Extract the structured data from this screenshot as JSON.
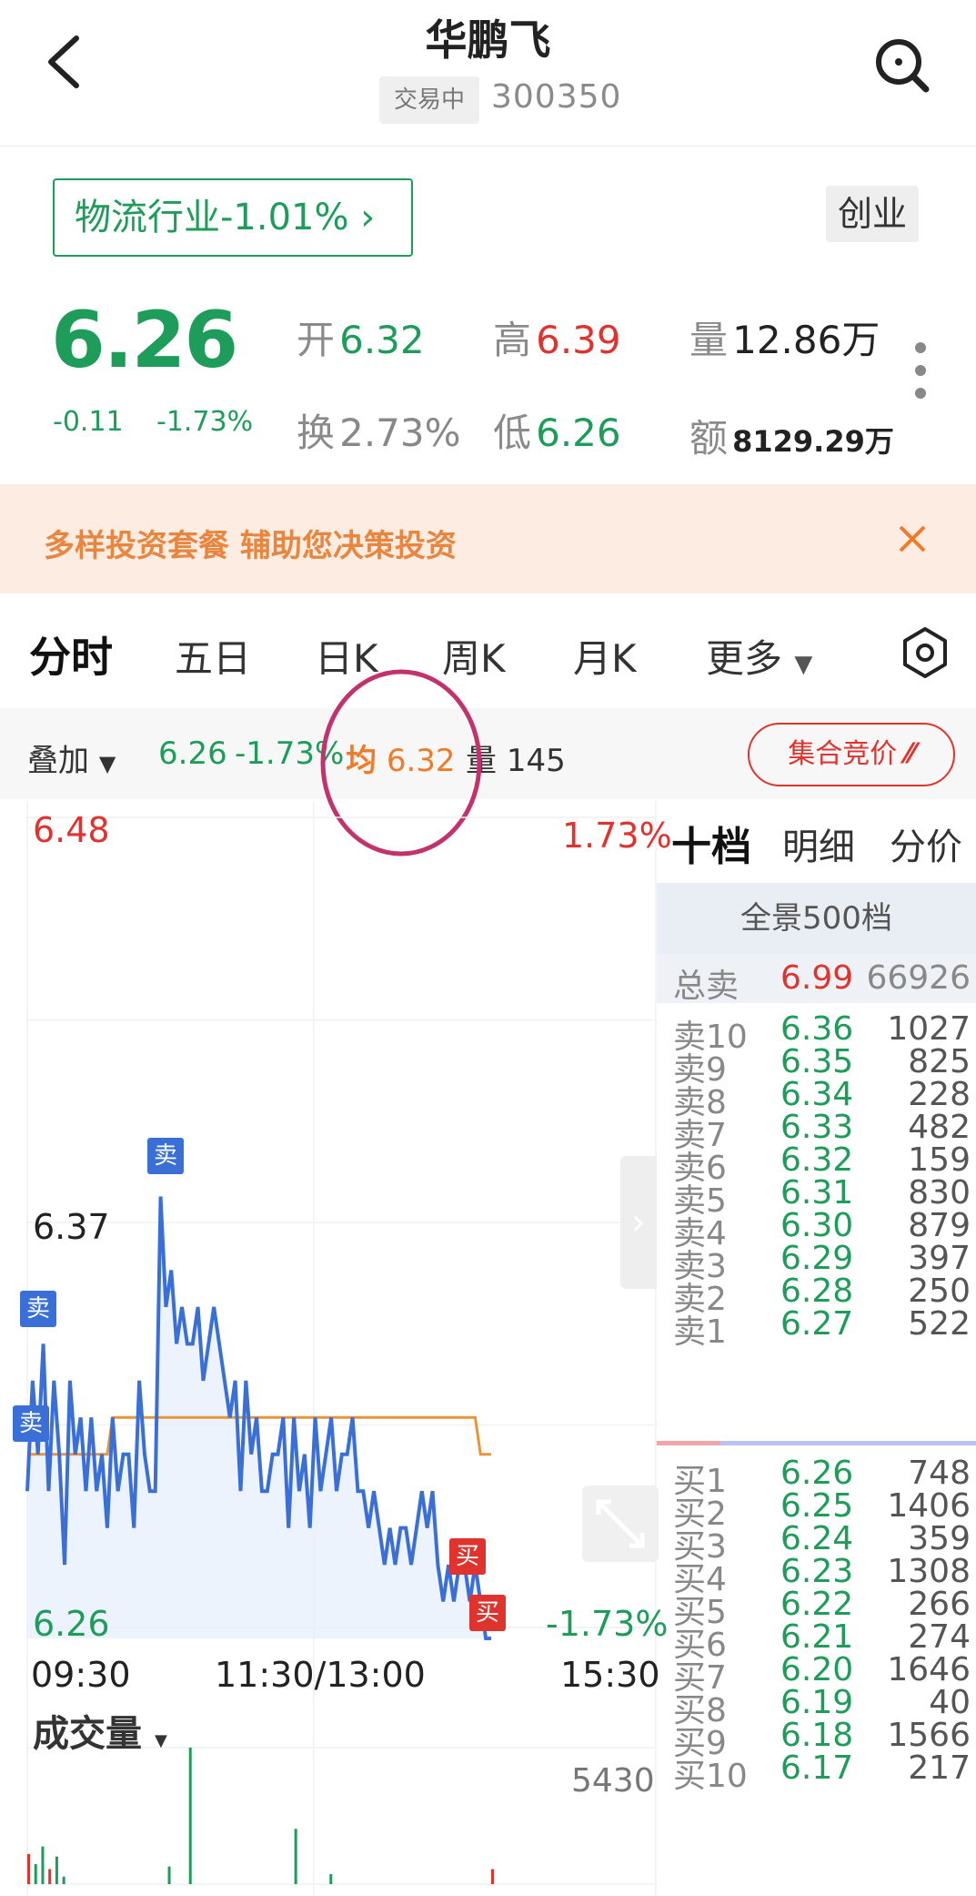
{
  "header": {
    "title": "华鹏飞",
    "status": "交易中",
    "code": "300350"
  },
  "sector": {
    "label": "物流行业-1.01% ",
    "board": "创业"
  },
  "quote": {
    "price": "6.26",
    "change_abs": "-0.11",
    "change_pct": "-1.73%",
    "open_label": "开",
    "open": "6.32",
    "high_label": "高",
    "high": "6.39",
    "volume_label": "量",
    "volume": "12.86万",
    "turnover_label": "换",
    "turnover": "2.73%",
    "low_label": "低",
    "low": "6.26",
    "amount_label": "额",
    "amount": "8129.29万"
  },
  "promo": {
    "text": "多样投资套餐 辅助您决策投资"
  },
  "tabs": [
    "分时",
    "五日",
    "日K",
    "周K",
    "月K",
    "更多"
  ],
  "toolbar": {
    "overlay": "叠加",
    "price": "6.26",
    "pct": "-1.73%",
    "avg_label": "均",
    "avg": "6.32",
    "vol_label": "量",
    "vol": "145",
    "auction": "集合竞价"
  },
  "chart": {
    "y_top": "6.48",
    "y_mid": "6.37",
    "y_bottom": "6.26",
    "pct_top": "1.73%",
    "pct_bottom": "-1.73%",
    "time_start": "09:30",
    "time_mid": "11:30/13:00",
    "time_end": "15:30",
    "volume_title": "成交量",
    "volume_max": "5430",
    "sell_marker": "卖",
    "buy_marker": "买"
  },
  "chart_data": {
    "type": "line",
    "title": "",
    "xlabel": "",
    "ylabel": "",
    "ylim": [
      6.26,
      6.48
    ],
    "x_ticks": [
      "09:30",
      "11:30/13:00",
      "15:30"
    ],
    "series": [
      {
        "name": "",
        "values": [
          6.3,
          6.33,
          6.31,
          6.34,
          6.3,
          6.33,
          6.31,
          6.28,
          6.33,
          6.31,
          6.32,
          6.3,
          6.32,
          6.3,
          6.31,
          6.29,
          6.32,
          6.3,
          6.31,
          6.31,
          6.29,
          6.33,
          6.31,
          6.3,
          6.3,
          6.38,
          6.35,
          6.36,
          6.34,
          6.35,
          6.34,
          6.34,
          6.35,
          6.33,
          6.34,
          6.35,
          6.34,
          6.33,
          6.32,
          6.33,
          6.3,
          6.33,
          6.31,
          6.32,
          6.3,
          6.3,
          6.31,
          6.31,
          6.32,
          6.29,
          6.32,
          6.3,
          6.31,
          6.29,
          6.32,
          6.3,
          6.31,
          6.32,
          6.3,
          6.31,
          6.31,
          6.32,
          6.3,
          6.3,
          6.29,
          6.3,
          6.29,
          6.28,
          6.29,
          6.28,
          6.29,
          6.29,
          6.28,
          6.29,
          6.3,
          6.29,
          6.3,
          6.28,
          6.27,
          6.28,
          6.27,
          6.28,
          6.28,
          6.27,
          6.28,
          6.27,
          6.26,
          6.26
        ]
      },
      {
        "name": "均",
        "values": [
          6.31,
          6.31,
          6.31,
          6.31,
          6.31,
          6.31,
          6.31,
          6.31,
          6.31,
          6.31,
          6.31,
          6.31,
          6.31,
          6.31,
          6.31,
          6.31,
          6.32,
          6.32,
          6.32,
          6.32,
          6.32,
          6.32,
          6.32,
          6.32,
          6.32,
          6.32,
          6.32,
          6.32,
          6.32,
          6.32,
          6.32,
          6.32,
          6.32,
          6.32,
          6.32,
          6.32,
          6.32,
          6.32,
          6.32,
          6.32,
          6.32,
          6.32,
          6.32,
          6.32,
          6.32,
          6.32,
          6.32,
          6.32,
          6.32,
          6.32,
          6.32,
          6.32,
          6.32,
          6.32,
          6.32,
          6.32,
          6.32,
          6.32,
          6.32,
          6.32,
          6.32,
          6.32,
          6.32,
          6.32,
          6.32,
          6.32,
          6.32,
          6.32,
          6.32,
          6.32,
          6.32,
          6.32,
          6.32,
          6.32,
          6.32,
          6.32,
          6.32,
          6.32,
          6.32,
          6.32,
          6.32,
          6.32,
          6.32,
          6.32,
          6.32,
          6.31,
          6.31,
          6.31
        ]
      }
    ],
    "volume_bars": [
      1200,
      800,
      1500,
      600,
      1100,
      300,
      0,
      0,
      0,
      0,
      0,
      0,
      0,
      0,
      0,
      0,
      0,
      0,
      0,
      0,
      700,
      0,
      0,
      5430,
      0,
      0,
      0,
      0,
      0,
      0,
      0,
      0,
      0,
      0,
      0,
      0,
      0,
      0,
      2200,
      0,
      0,
      0,
      0,
      400,
      0,
      0,
      0,
      0,
      0,
      0,
      0,
      0,
      0,
      0,
      0,
      0,
      0,
      0,
      0,
      0,
      0,
      0,
      0,
      0,
      0,
      0,
      600
    ]
  },
  "orderbook": {
    "tabs": [
      "十档",
      "明细",
      "分价"
    ],
    "panorama": "全景500档",
    "total": {
      "label": "总卖",
      "price": "6.99",
      "vol": "66926"
    },
    "sells": [
      {
        "label": "卖10",
        "price": "6.36",
        "vol": "1027"
      },
      {
        "label": "卖9",
        "price": "6.35",
        "vol": "825"
      },
      {
        "label": "卖8",
        "price": "6.34",
        "vol": "228"
      },
      {
        "label": "卖7",
        "price": "6.33",
        "vol": "482"
      },
      {
        "label": "卖6",
        "price": "6.32",
        "vol": "159"
      },
      {
        "label": "卖5",
        "price": "6.31",
        "vol": "830"
      },
      {
        "label": "卖4",
        "price": "6.30",
        "vol": "879"
      },
      {
        "label": "卖3",
        "price": "6.29",
        "vol": "397"
      },
      {
        "label": "卖2",
        "price": "6.28",
        "vol": "250"
      },
      {
        "label": "卖1",
        "price": "6.27",
        "vol": "522"
      }
    ],
    "buys": [
      {
        "label": "买1",
        "price": "6.26",
        "vol": "748"
      },
      {
        "label": "买2",
        "price": "6.25",
        "vol": "1406"
      },
      {
        "label": "买3",
        "price": "6.24",
        "vol": "359"
      },
      {
        "label": "买4",
        "price": "6.23",
        "vol": "1308"
      },
      {
        "label": "买5",
        "price": "6.22",
        "vol": "266"
      },
      {
        "label": "买6",
        "price": "6.21",
        "vol": "274"
      },
      {
        "label": "买7",
        "price": "6.20",
        "vol": "1646"
      },
      {
        "label": "买8",
        "price": "6.19",
        "vol": "40"
      },
      {
        "label": "买9",
        "price": "6.18",
        "vol": "1566"
      },
      {
        "label": "买10",
        "price": "6.17",
        "vol": "217"
      }
    ]
  },
  "colors": {
    "up": "#e0332e",
    "down": "#1e9d5a",
    "line": "#3a6fd8",
    "avg": "#e8953a",
    "accent": "#c2336e"
  }
}
